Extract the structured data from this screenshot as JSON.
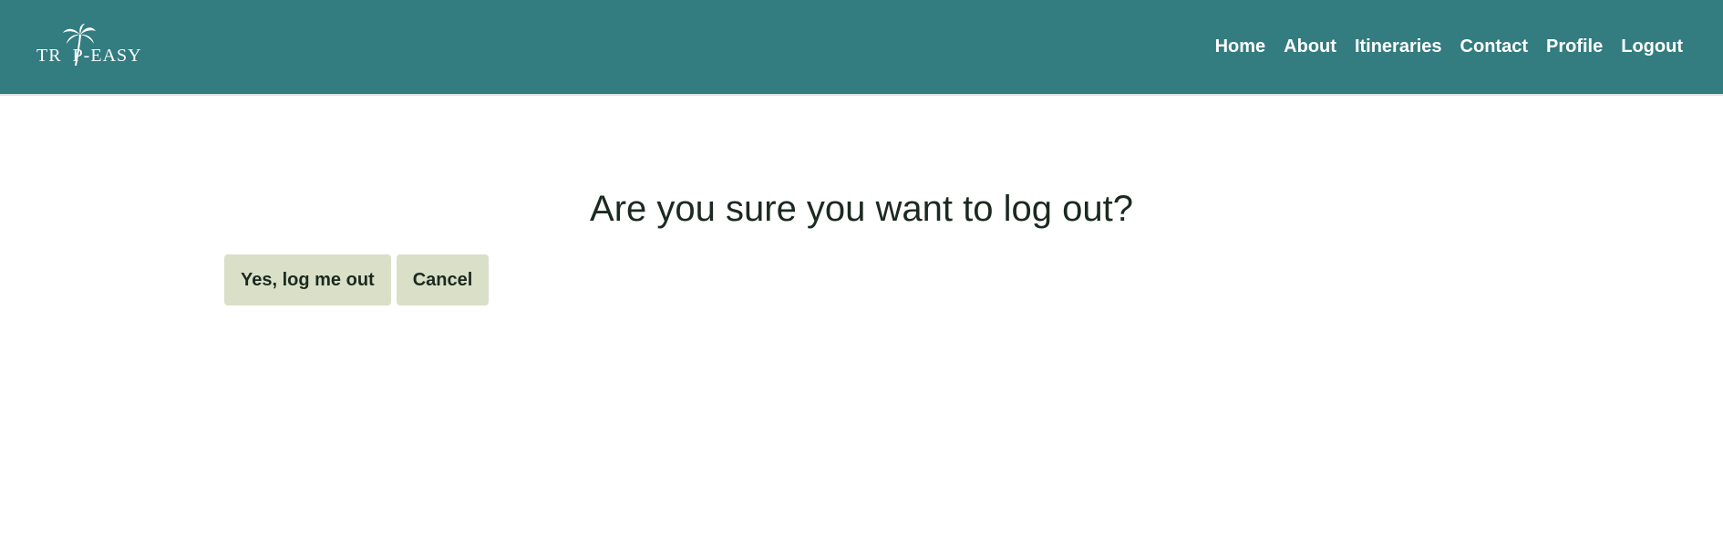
{
  "brand": {
    "logo_text": "TRIP-EASY",
    "logo_text_left": "TR",
    "logo_text_right": "P-EASY",
    "logo_icon": "palm-tree-icon"
  },
  "nav": {
    "items": [
      {
        "label": "Home"
      },
      {
        "label": "About"
      },
      {
        "label": "Itineraries"
      },
      {
        "label": "Contact"
      },
      {
        "label": "Profile"
      },
      {
        "label": "Logout"
      }
    ]
  },
  "main": {
    "heading": "Are you sure you want to log out?",
    "confirm_label": "Yes, log me out",
    "cancel_label": "Cancel"
  },
  "colors": {
    "navbar_bg": "#337c80",
    "button_bg": "#dadfc8",
    "text_dark": "#1b2a20"
  }
}
